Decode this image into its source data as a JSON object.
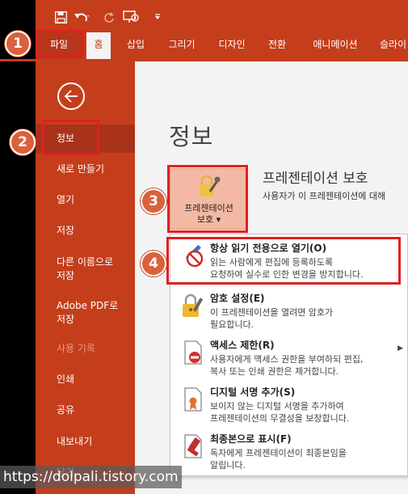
{
  "qat": {
    "icons": [
      "save-icon",
      "undo-icon",
      "redo-icon",
      "present-from-start-icon",
      "customize-qat-icon"
    ]
  },
  "tabs": {
    "file": "파일",
    "home": "홈",
    "insert": "삽입",
    "draw": "그리기",
    "design": "디자인",
    "transitions": "전환",
    "animations": "애니메이션",
    "slideshow": "슬라이"
  },
  "sidebar": {
    "back_icon": "back-arrow-icon",
    "items": [
      {
        "label": "정보",
        "active": true
      },
      {
        "label": "새로 만들기"
      },
      {
        "label": "열기"
      },
      {
        "label": "저장"
      },
      {
        "label": "다른 이름으로\n저장"
      },
      {
        "label": "Adobe PDF로\n저장"
      },
      {
        "label": "사용 기록",
        "disabled": true
      },
      {
        "label": "인쇄"
      },
      {
        "label": "공유"
      },
      {
        "label": "내보내기"
      },
      {
        "label": "닫기"
      }
    ]
  },
  "main": {
    "title": "정보",
    "protect_button": {
      "line1": "프레젠테이션",
      "line2": "보호 ▾"
    },
    "section_title": "프레젠테이션 보호",
    "section_desc": "사용자가 이 프레젠테이션에 대해"
  },
  "dropdown": {
    "items": [
      {
        "title": "항상 읽기 전용으로 열기(O)",
        "desc": "읽는 사람에게 편집에 등록하도록\n요청하여 실수로 인한 변경을 방지합니다.",
        "icon": "pencil-prohibited-icon"
      },
      {
        "title": "암호 설정(E)",
        "desc": "이 프레젠테이션을 열려면 암호가\n필요합니다.",
        "icon": "lock-pen-icon"
      },
      {
        "title": "액세스 제한(R)",
        "desc": "사용자에게 액세스 권한을 부여하되 편집,\n복사 또는 인쇄 권한은 제거합니다.",
        "icon": "restrict-access-icon",
        "has_submenu": true
      },
      {
        "title": "디지털 서명 추가(S)",
        "desc": "보이지 않는 디지털 서명을 추가하여\n프레젠테이션의 무결성을 보장합니다.",
        "icon": "digital-signature-icon"
      },
      {
        "title": "최종본으로 표시(F)",
        "desc": "독자에게 프레젠테이션이 최종본임을\n알립니다.",
        "icon": "mark-final-icon"
      }
    ]
  },
  "callouts": [
    "1",
    "2",
    "3",
    "4"
  ],
  "watermark": "https://dolpali.tistory.com",
  "colors": {
    "accent": "#c43e1c",
    "sidebar_active": "#a8321a",
    "callout_red": "#e02020",
    "badge": "#d9623c"
  }
}
